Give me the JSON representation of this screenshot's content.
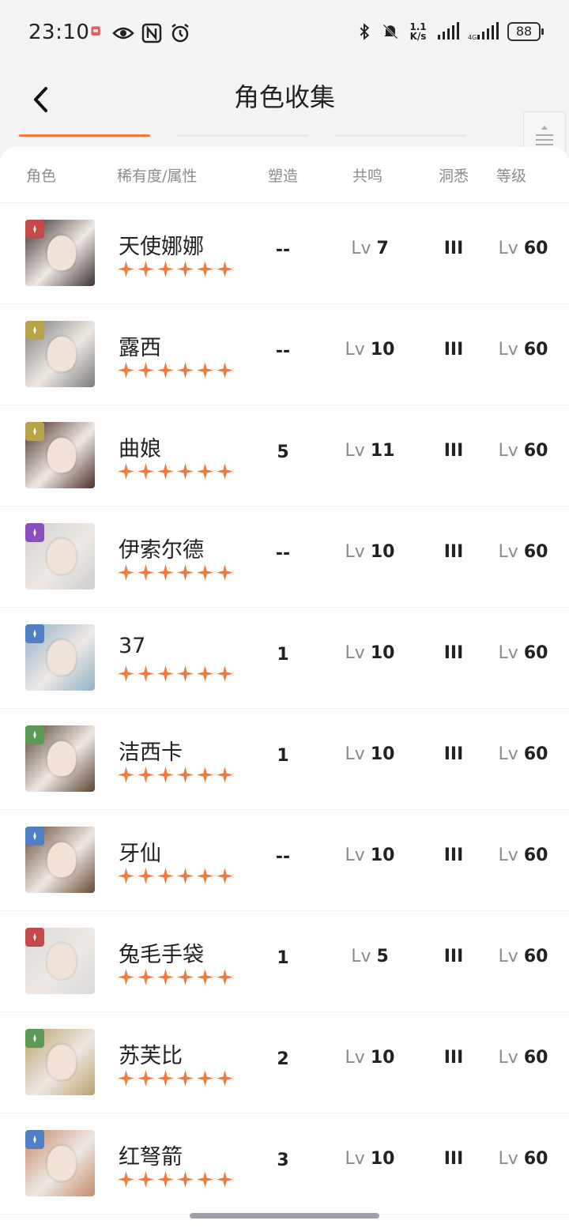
{
  "status": {
    "time": "23:10",
    "net_speed_top": "1.1",
    "net_speed_bottom": "K/s",
    "battery": "88"
  },
  "nav": {
    "title": "角色收集"
  },
  "header": {
    "role": "角色",
    "rarity": "稀有度/属性",
    "shape": "塑造",
    "resonance": "共鸣",
    "insight": "洞悉",
    "level": "等级"
  },
  "lv_prefix": "Lv",
  "colors": {
    "accent": "#f07a3a",
    "star": "#f07a3a"
  },
  "characters": [
    {
      "name": "天使娜娜",
      "shape": "--",
      "resonance": "7",
      "insight": "III",
      "level": "60",
      "element_color": "#c44a4a",
      "portrait": "#3a3030"
    },
    {
      "name": "露西",
      "shape": "--",
      "resonance": "10",
      "insight": "III",
      "level": "60",
      "element_color": "#b8a24a",
      "portrait": "#7c7c7c"
    },
    {
      "name": "曲娘",
      "shape": "5",
      "resonance": "11",
      "insight": "III",
      "level": "60",
      "element_color": "#b8a24a",
      "portrait": "#4b3027"
    },
    {
      "name": "伊索尔德",
      "shape": "--",
      "resonance": "10",
      "insight": "III",
      "level": "60",
      "element_color": "#8a4fbd",
      "portrait": "#cfcfcf"
    },
    {
      "name": "37",
      "shape": "1",
      "resonance": "10",
      "insight": "III",
      "level": "60",
      "element_color": "#4f7fc4",
      "portrait": "#8fb2c8"
    },
    {
      "name": "洁西卡",
      "shape": "1",
      "resonance": "10",
      "insight": "III",
      "level": "60",
      "element_color": "#5a9a55",
      "portrait": "#5b4332"
    },
    {
      "name": "牙仙",
      "shape": "--",
      "resonance": "10",
      "insight": "III",
      "level": "60",
      "element_color": "#4f7fc4",
      "portrait": "#6a4a35"
    },
    {
      "name": "兔毛手袋",
      "shape": "1",
      "resonance": "5",
      "insight": "III",
      "level": "60",
      "element_color": "#c44a4a",
      "portrait": "#d9d9d9"
    },
    {
      "name": "苏芙比",
      "shape": "2",
      "resonance": "10",
      "insight": "III",
      "level": "60",
      "element_color": "#5a9a55",
      "portrait": "#b9a06a"
    },
    {
      "name": "红弩箭",
      "shape": "3",
      "resonance": "10",
      "insight": "III",
      "level": "60",
      "element_color": "#4f7fc4",
      "portrait": "#c58a6a"
    }
  ]
}
